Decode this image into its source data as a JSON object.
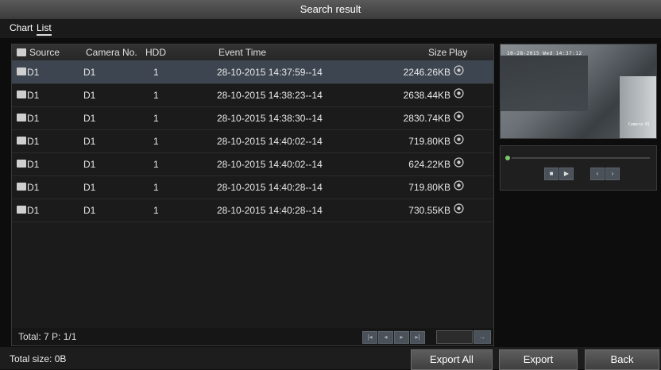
{
  "window": {
    "title": "Search result"
  },
  "tabs": [
    {
      "label": "Chart"
    },
    {
      "label": "List"
    }
  ],
  "table": {
    "headers": {
      "source": "Source",
      "camera": "Camera No.",
      "hdd": "HDD",
      "event_time": "Event Time",
      "size": "Size",
      "play": "Play"
    },
    "rows": [
      {
        "source": "D1",
        "camera": "D1",
        "hdd": "1",
        "event_time": "28-10-2015 14:37:59--14",
        "size": "2246.26KB",
        "selected": true
      },
      {
        "source": "D1",
        "camera": "D1",
        "hdd": "1",
        "event_time": "28-10-2015 14:38:23--14",
        "size": "2638.44KB"
      },
      {
        "source": "D1",
        "camera": "D1",
        "hdd": "1",
        "event_time": "28-10-2015 14:38:30--14",
        "size": "2830.74KB"
      },
      {
        "source": "D1",
        "camera": "D1",
        "hdd": "1",
        "event_time": "28-10-2015 14:40:02--14",
        "size": "719.80KB"
      },
      {
        "source": "D1",
        "camera": "D1",
        "hdd": "1",
        "event_time": "28-10-2015 14:40:02--14",
        "size": "624.22KB"
      },
      {
        "source": "D1",
        "camera": "D1",
        "hdd": "1",
        "event_time": "28-10-2015 14:40:28--14",
        "size": "719.80KB"
      },
      {
        "source": "D1",
        "camera": "D1",
        "hdd": "1",
        "event_time": "28-10-2015 14:40:28--14",
        "size": "730.55KB"
      }
    ]
  },
  "pager": {
    "total": "Total: 7  P: 1/1"
  },
  "footer": {
    "total_size": "Total size: 0B"
  },
  "buttons": {
    "export_all": "Export All",
    "export": "Export",
    "back": "Back"
  },
  "preview": {
    "timestamp": "10-28-2015 Wed 14:37:12",
    "camera_label": "Camera 01"
  },
  "colors": {
    "selected_row": "#3d4650",
    "progress_dot": "#7ec96f"
  },
  "icons": {
    "play": "eye-icon",
    "row_check": "checkbox-icon"
  }
}
